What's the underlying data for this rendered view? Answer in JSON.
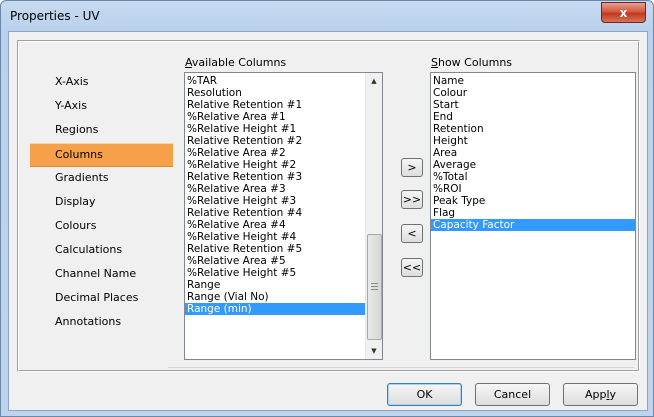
{
  "window": {
    "title": "Properties - UV",
    "close_label": "x"
  },
  "nav": {
    "items": [
      {
        "label": "X-Axis"
      },
      {
        "label": "Y-Axis"
      },
      {
        "label": "Regions"
      },
      {
        "label": "Columns",
        "selected": true
      },
      {
        "label": "Gradients"
      },
      {
        "label": "Display"
      },
      {
        "label": "Colours"
      },
      {
        "label": "Calculations"
      },
      {
        "label": "Channel Name"
      },
      {
        "label": "Decimal Places"
      },
      {
        "label": "Annotations"
      }
    ]
  },
  "available": {
    "label_accel": "A",
    "label_rest": "vailable Columns",
    "items": [
      "%TAR",
      "Resolution",
      "Relative Retention #1",
      "%Relative Area #1",
      "%Relative Height #1",
      "Relative Retention #2",
      "%Relative Area #2",
      "%Relative Height #2",
      "Relative Retention #3",
      "%Relative Area #3",
      "%Relative Height #3",
      "Relative Retention #4",
      "%Relative Area #4",
      "%Relative Height #4",
      "Relative Retention #5",
      "%Relative Area #5",
      "%Relative Height #5",
      "Range",
      "Range (Vial No)",
      "Range (min)"
    ],
    "selected_index": 19
  },
  "show": {
    "label_accel": "S",
    "label_rest": "how Columns",
    "items": [
      "Name",
      "Colour",
      "Start",
      "End",
      "Retention",
      "Height",
      "Area",
      "Average",
      "%Total",
      "%ROI",
      "Peak Type",
      "Flag",
      "Capacity Factor"
    ],
    "selected_index": 12
  },
  "move_buttons": {
    "add": ">",
    "add_all": ">>",
    "remove": "<",
    "remove_all": "<<"
  },
  "footer": {
    "ok": "OK",
    "cancel": "Cancel",
    "apply": "Apply"
  }
}
